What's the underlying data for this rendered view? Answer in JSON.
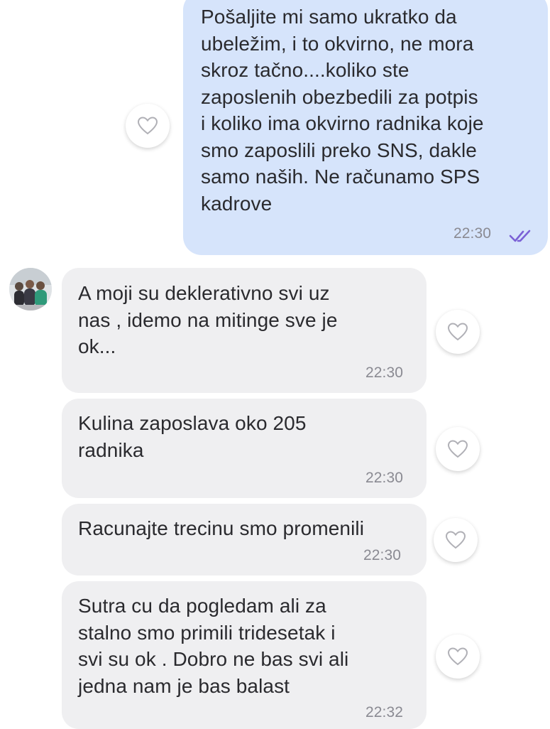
{
  "messages": [
    {
      "direction": "out",
      "text": "Pošaljite mi samo ukratko da\nubeležim, i to okvirno, ne mora\nskroz tačno....koliko ste\nzaposlenih obezbedili za potpis\ni koliko ima okvirno radnika koje\nsmo zaposlili preko SNS, dakle\nsamo naših. Ne računamo SPS\nkadrove",
      "time": "22:30",
      "status": "read"
    },
    {
      "direction": "in",
      "text": "A moji su deklerativno svi uz\nnas , idemo na mitinge sve je\nok...",
      "time": "22:30"
    },
    {
      "direction": "in",
      "text": "Kulina zaposlava oko 205\nradnika",
      "time": "22:30"
    },
    {
      "direction": "in",
      "text": "Racunajte trecinu smo promenili",
      "time": "22:30"
    },
    {
      "direction": "in",
      "text": "Sutra cu da pogledam ali za\nstalno smo primili tridesetak i\nsvi su ok . Dobro ne bas svi ali\njedna nam je bas balast",
      "time": "22:32"
    }
  ],
  "icons": {
    "like": "heart-outline-icon",
    "read_receipt": "double-check-icon",
    "contact_avatar": "group-photo-avatar"
  },
  "colors": {
    "outgoing_bubble": "#d6e4fb",
    "incoming_bubble": "#efeff1",
    "read_ticks": "#7b61d6",
    "timestamp": "#8a8a92"
  }
}
